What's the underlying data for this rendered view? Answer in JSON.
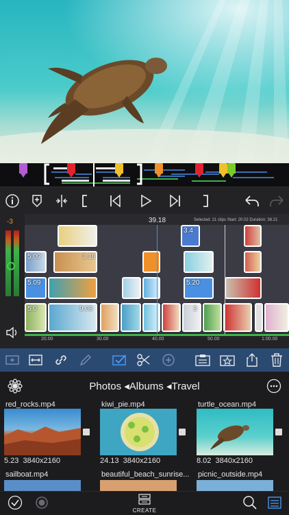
{
  "colors": {
    "accent": "#4a90e2",
    "markerPurple": "#b35cd6",
    "markerRed": "#e0242e",
    "markerYellow": "#f0c02a",
    "markerOrange": "#f0902a",
    "markerGreen": "#7acb2a",
    "editbar": "#2b4a72",
    "level": "#3db34a"
  },
  "toolbar": {
    "icons": [
      "info-icon",
      "marker-icon",
      "split-icon",
      "in-point-icon",
      "skip-back-icon",
      "play-icon",
      "skip-forward-icon",
      "out-point-icon",
      "undo-icon",
      "redo-icon"
    ]
  },
  "timeline": {
    "playhead_time": "39.18",
    "selection_info": "Selected: 21 clips  Start: 20.02  Duration: 38.21",
    "level_value": "-3",
    "ruler": [
      "20.00",
      "30.00",
      "40.00",
      "50.00",
      "1:00.00"
    ],
    "clip_labels": {
      "c1": "5.09",
      "c2": "3.18",
      "c3": "5.09",
      "c4": "5.20",
      "c5": "5.0",
      "c6": "9.08",
      "c7": "3",
      "c8": "3.4"
    }
  },
  "editbar": {
    "icons": [
      "add-track-icon",
      "fit-icon",
      "link-icon",
      "pencil-icon",
      "select-icon",
      "scissors-icon",
      "add-icon",
      "clipboard-icon",
      "favorite-icon",
      "share-icon",
      "trash-icon"
    ]
  },
  "browser": {
    "breadcrumb": "Photos ◂Albums ◂Travel",
    "more_icon": "ellipsis-icon",
    "items": [
      {
        "name": "red_rocks.mp4",
        "duration": "5.23",
        "resolution": "3840x2160"
      },
      {
        "name": "kiwi_pie.mp4",
        "duration": "24.13",
        "resolution": "3840x2160"
      },
      {
        "name": "turtle_ocean.mp4",
        "duration": "8.02",
        "resolution": "3840x2160"
      },
      {
        "name": "sailboat.mp4",
        "duration": "",
        "resolution": ""
      },
      {
        "name": "beautiful_beach_sunrise...",
        "duration": "",
        "resolution": ""
      },
      {
        "name": "picnic_outside.mp4",
        "duration": "",
        "resolution": ""
      }
    ]
  },
  "bottom": {
    "create_label": "CREATE"
  }
}
